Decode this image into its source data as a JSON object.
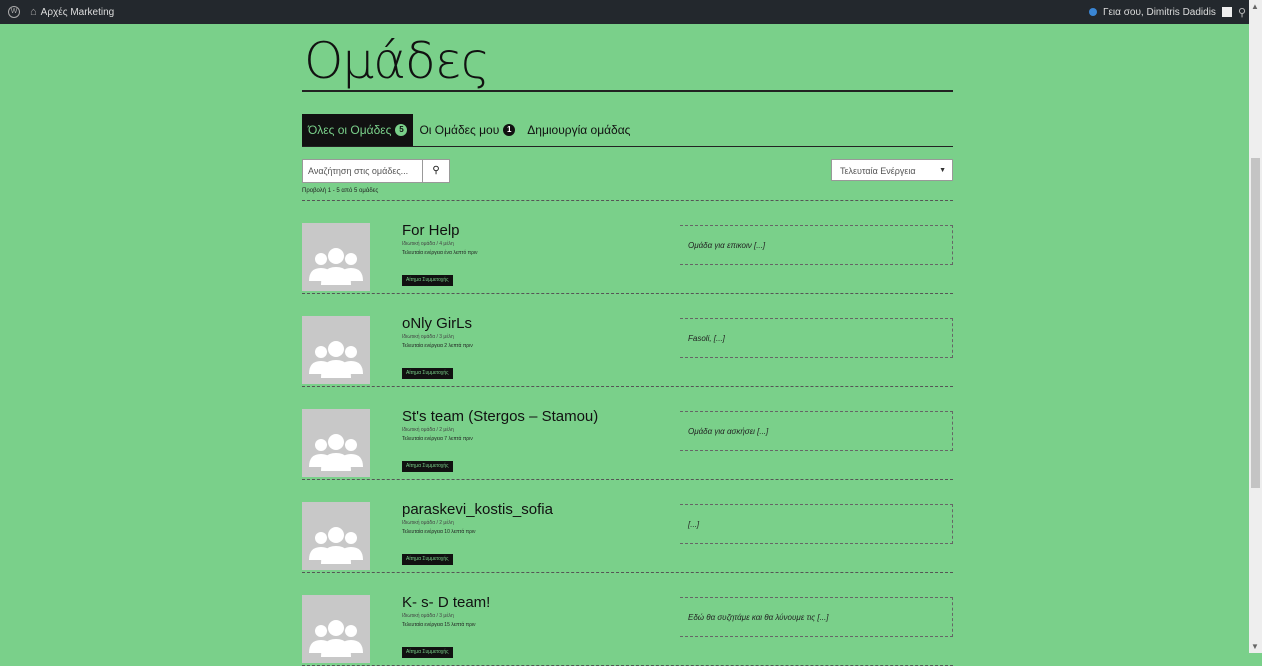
{
  "adminbar": {
    "site_name": "Αρχές Marketing",
    "greeting": "Γεια σου, Dimitris Dadidis"
  },
  "page": {
    "title": "Ομάδες"
  },
  "tabs": [
    {
      "label": "Όλες οι Ομάδες",
      "count": "5"
    },
    {
      "label": "Οι Ομάδες μου",
      "count": "1"
    },
    {
      "label": "Δημιουργία ομάδας"
    }
  ],
  "search": {
    "placeholder": "Αναζήτηση στις ομάδες..."
  },
  "order": {
    "selected": "Τελευταία Ενέργεια"
  },
  "pagination": {
    "count_text": "Προβολή 1 - 5 από 5 ομάδες"
  },
  "groups": [
    {
      "name": "For Help",
      "meta": "Ιδιωτική ομάδα / 4 μέλη",
      "last_active": "Τελευταία ενέργεια ένα λεπτό πριν",
      "button": "Αίτημα Συμμετοχής",
      "description": "Ομάδα για επικοιν [...]"
    },
    {
      "name": "oNly GirLs",
      "meta": "Ιδιωτική ομάδα / 3 μέλη",
      "last_active": "Τελευταία ενέργεια 2 λεπτά πριν",
      "button": "Αίτημα Συμμετοχής",
      "description": "Fasoli, [...]"
    },
    {
      "name": "St's team (Stergos – Stamou)",
      "meta": "Ιδιωτική ομάδα / 2 μέλη",
      "last_active": "Τελευταία ενέργεια 7 λεπτά πριν",
      "button": "Αίτημα Συμμετοχής",
      "description": "Ομάδα για ασκήσει [...]"
    },
    {
      "name": "paraskevi_kostis_sofia",
      "meta": "Ιδιωτική ομάδα / 2 μέλη",
      "last_active": "Τελευταία ενέργεια 10 λεπτά πριν",
      "button": "Αίτημα Συμμετοχής",
      "description": "[...]"
    },
    {
      "name": "K- s- D team!",
      "meta": "Ιδιωτική ομάδα / 3 μέλη",
      "last_active": "Τελευταία ενέργεια 15 λεπτά πριν",
      "button": "Αίτημα Συμμετοχής",
      "description": "Εδώ θα συζητάμε και θα λύνουμε τις [...]"
    }
  ]
}
